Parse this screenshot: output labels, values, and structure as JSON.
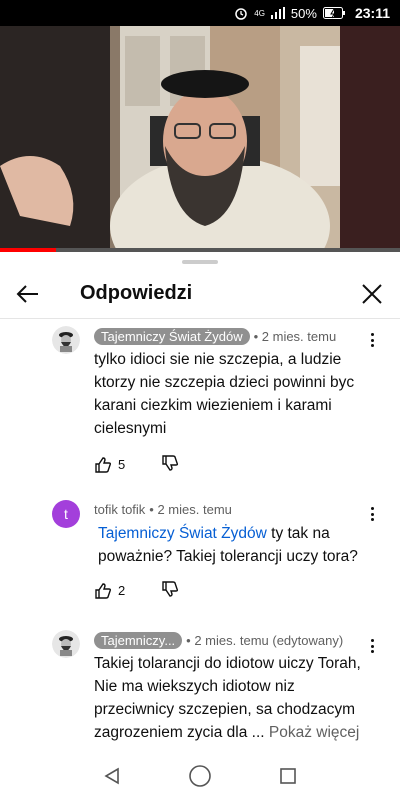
{
  "status_bar": {
    "network": "4G",
    "battery": "50%",
    "time": "23:11"
  },
  "video": {
    "progress": 0.14
  },
  "header": {
    "title": "Odpowiedzi"
  },
  "comments": [
    {
      "author": "Tajemniczy Świat Żydów",
      "time": "• 2 mies. temu",
      "text": "tylko idioci sie nie szczepia, a ludzie ktorzy nie szczepia dzieci powinni byc karani ciezkim wiezieniem i karami cielesnymi",
      "likes": "5"
    },
    {
      "author": "tofik tofik",
      "avatar_letter": "t",
      "time": "• 2 mies. temu",
      "mention": "Tajemniczy Świat Żydów",
      "text": " ty tak na poważnie? Takiej tolerancji uczy tora?",
      "likes": "2"
    },
    {
      "author": "Tajemniczy...",
      "time": "• 2 mies. temu (edytowany)",
      "text": "Takiej tolarancji do idiotow uiczy Torah, Nie ma wiekszych idiotow niz przeciwnicy szczepien, sa chodzacym zagrozeniem zycia dla ...",
      "more": "Pokaż więcej"
    }
  ],
  "colors": {
    "mention": "#065fd4",
    "avatar_purple": "#a33fdb",
    "progress_red": "#ff0000"
  }
}
